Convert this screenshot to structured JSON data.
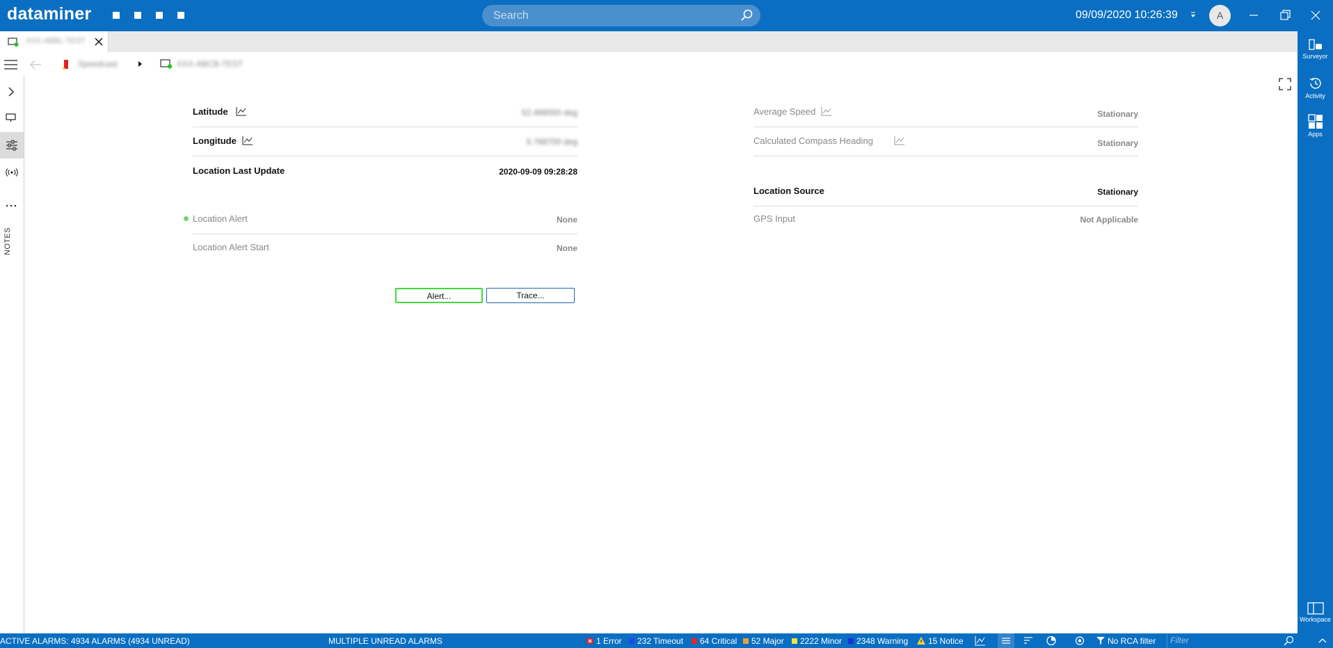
{
  "app": {
    "logo": "dataminer",
    "search_placeholder": "Search",
    "datetime": "09/09/2020 10:26:39",
    "user_initial": "A"
  },
  "tab": {
    "label": "XXX-ABBL-TEST"
  },
  "breadcrumb": {
    "service": "Speedcast",
    "element": "XXX-ABCB-TEST"
  },
  "leftbar": {
    "notes_label": "NOTES"
  },
  "params_left": [
    {
      "label": "Latitude",
      "value": "52.468000 deg"
    },
    {
      "label": "Longitude",
      "value": "5.768700 deg"
    },
    {
      "label": "Location Last Update",
      "value": "2020-09-09 09:28:28"
    },
    {
      "label": "Location Alert",
      "value": "None"
    },
    {
      "label": "Location Alert Start",
      "value": "None"
    }
  ],
  "params_right": [
    {
      "label": "Average Speed",
      "value": "Stationary"
    },
    {
      "label": "Calculated Compass Heading",
      "value": "Stationary"
    },
    {
      "label": "Location Source",
      "value": "Stationary"
    },
    {
      "label": "GPS Input",
      "value": "Not Applicable"
    }
  ],
  "buttons": {
    "alert": "Alert...",
    "trace": "Trace..."
  },
  "rightbar": {
    "surveyor": "Surveyor",
    "activity": "Activity",
    "apps": "Apps",
    "workspace": "Workspace"
  },
  "statusbar": {
    "active_alarms": "ACTIVE ALARMS: 4934 ALARMS (4934 UNREAD)",
    "multiple_unread": "MULTIPLE UNREAD ALARMS",
    "error": "1 Error",
    "timeout": "232 Timeout",
    "critical": "64 Critical",
    "major": "52 Major",
    "minor": "2222 Minor",
    "warning": "2348 Warning",
    "notice": "15 Notice",
    "rca": "No RCA filter",
    "filter_placeholder": "Filter"
  },
  "colors": {
    "brand_blue": "#0a6fc2",
    "critical": "#e3262a",
    "major": "#f0a030",
    "minor": "#f5e23a",
    "warning": "#1a2fd8",
    "timeout": "#2244ee",
    "ok_green": "#3cdc3c"
  }
}
